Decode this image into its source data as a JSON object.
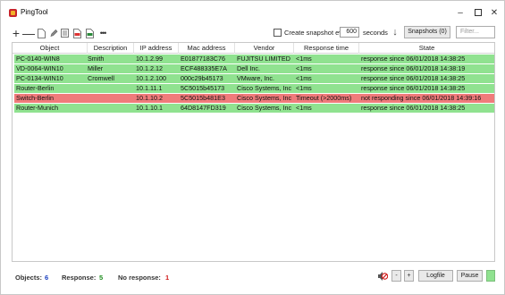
{
  "window": {
    "title": "PingTool",
    "minimize": "–",
    "close": "✕"
  },
  "toolbar": {
    "add": "+",
    "remove": "—",
    "more": "•••",
    "snapshot_label": "Create snapshot every",
    "snapshot_interval": "600",
    "seconds_label": "seconds",
    "snapshots_button": "Snapshots (0)",
    "filter_placeholder": "Filter..."
  },
  "columns": [
    "Object",
    "Description",
    "IP address",
    "Mac address",
    "Vendor",
    "Response time",
    "State"
  ],
  "rows": [
    {
      "object": "PC-0140-WIN8",
      "description": "Smith",
      "ip": "10.1.2.99",
      "mac": "E01877183C76",
      "vendor": "FUJITSU LIMITED",
      "response": "<1ms",
      "state": "response since 06/01/2018 14:38:25",
      "status": "ok"
    },
    {
      "object": "VD-0064-WIN10",
      "description": "Miller",
      "ip": "10.1.2.12",
      "mac": "ECF488335E7A",
      "vendor": "Dell Inc.",
      "response": "<1ms",
      "state": "response since 06/01/2018 14:38:19",
      "status": "ok"
    },
    {
      "object": "PC-0134-WIN10",
      "description": "Cromwell",
      "ip": "10.1.2.100",
      "mac": "000c29b45173",
      "vendor": "VMware, Inc.",
      "response": "<1ms",
      "state": "response since 06/01/2018 14:38:25",
      "status": "ok"
    },
    {
      "object": "Router-Berlin",
      "description": "",
      "ip": "10.1.11.1",
      "mac": "5C5015b45173",
      "vendor": "Cisco Systems, Inc",
      "response": "<1ms",
      "state": "response since 06/01/2018 14:38:25",
      "status": "ok"
    },
    {
      "object": "Switch-Berlin",
      "description": "",
      "ip": "10.1.10.2",
      "mac": "5C5015b481E3",
      "vendor": "Cisco Systems, Inc",
      "response": "Timeout (>2000ms)",
      "state": "not responding since 06/01/2018 14:39:16",
      "status": "fail"
    },
    {
      "object": "Router-Munich",
      "description": "",
      "ip": "10.1.10.1",
      "mac": "64D8147FD319",
      "vendor": "Cisco Systems, Inc",
      "response": "<1ms",
      "state": "response since 06/01/2018 14:38:25",
      "status": "ok"
    }
  ],
  "status": {
    "objects_label": "Objects:",
    "objects_value": "6",
    "response_label": "Response:",
    "response_value": "5",
    "noresponse_label": "No response:",
    "noresponse_value": "1",
    "zoom_out": "-",
    "zoom_in": "+",
    "logfile_button": "Logfile",
    "pause_button": "Pause"
  },
  "colors": {
    "row_ok": "#90e290",
    "row_fail": "#f07b7b",
    "objects_value": "#1a3fbf",
    "response_value": "#1e8c1e",
    "noresponse_value": "#d01818"
  }
}
